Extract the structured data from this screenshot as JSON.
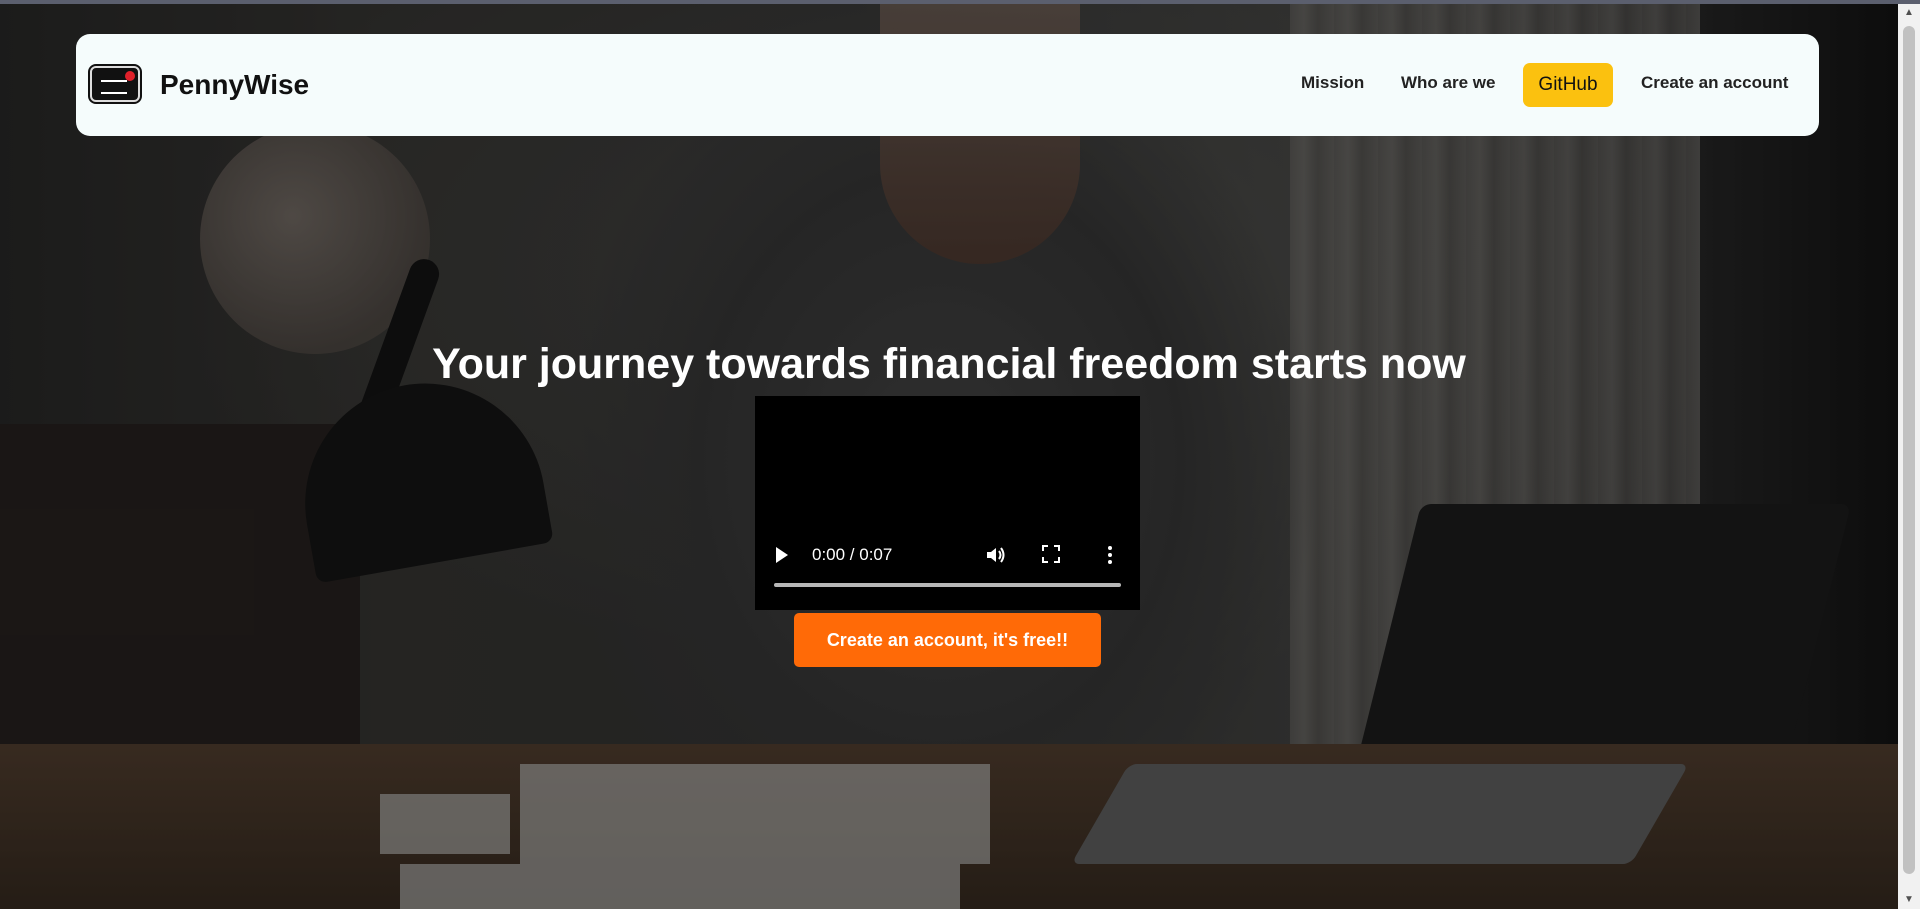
{
  "navbar": {
    "brand": "PennyWise",
    "links": {
      "mission": "Mission",
      "who_are_we": "Who are we",
      "github": "GitHub",
      "create_account": "Create an account"
    }
  },
  "hero": {
    "title": "Your journey towards financial freedom starts now",
    "video": {
      "time": "0:00 / 0:07",
      "progress": 0
    },
    "cta_label": "Create an account, it's free!!"
  },
  "colors": {
    "navbar_bg": "#f5fcfc",
    "github_button": "#fbc10f",
    "cta_button": "#ff6a07"
  },
  "icons": [
    "logo-icon",
    "play-icon",
    "volume-icon",
    "fullscreen-icon",
    "more-options-icon"
  ]
}
